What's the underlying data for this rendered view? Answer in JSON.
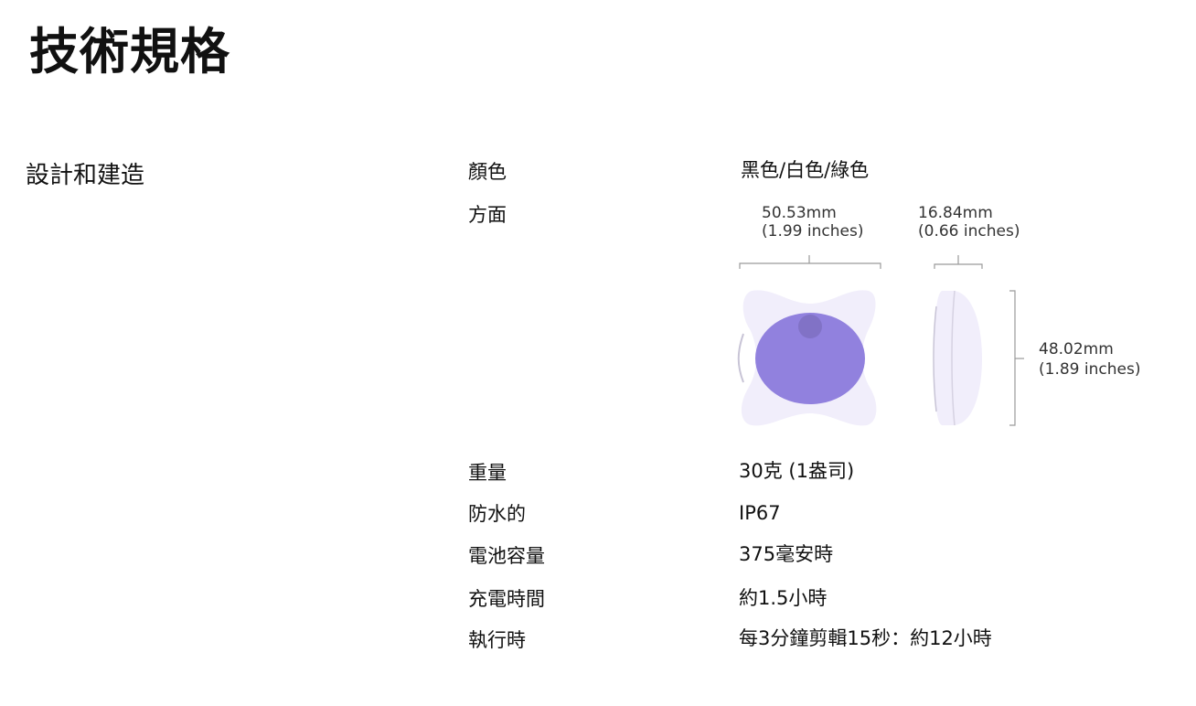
{
  "page": {
    "title": "技術規格"
  },
  "section": {
    "title": "設計和建造"
  },
  "specs": [
    {
      "label": "顏色",
      "value": "黑色/白色/綠色"
    },
    {
      "label": "方面",
      "value": ""
    },
    {
      "label": "重量",
      "value": "30克 (1盎司)"
    },
    {
      "label": "防水的",
      "value": "IP67"
    },
    {
      "label": "電池容量",
      "value": "375毫安時"
    },
    {
      "label": "充電時間",
      "value": "約1.5小時"
    },
    {
      "label": "執行時",
      "value": "每3分鐘剪輯15秒：約12小時"
    }
  ],
  "dimensions": {
    "width_mm": "50.53mm",
    "width_in": "(1.99 inches)",
    "depth_mm": "16.84mm",
    "depth_in": "(0.66 inches)",
    "height_mm": "48.02mm",
    "height_in": "(1.89 inches)"
  },
  "colors": {
    "device_body": "#f1eefb",
    "device_accent": "#9181de",
    "device_button": "#8172c6",
    "bracket_line": "#9a9a9a"
  }
}
